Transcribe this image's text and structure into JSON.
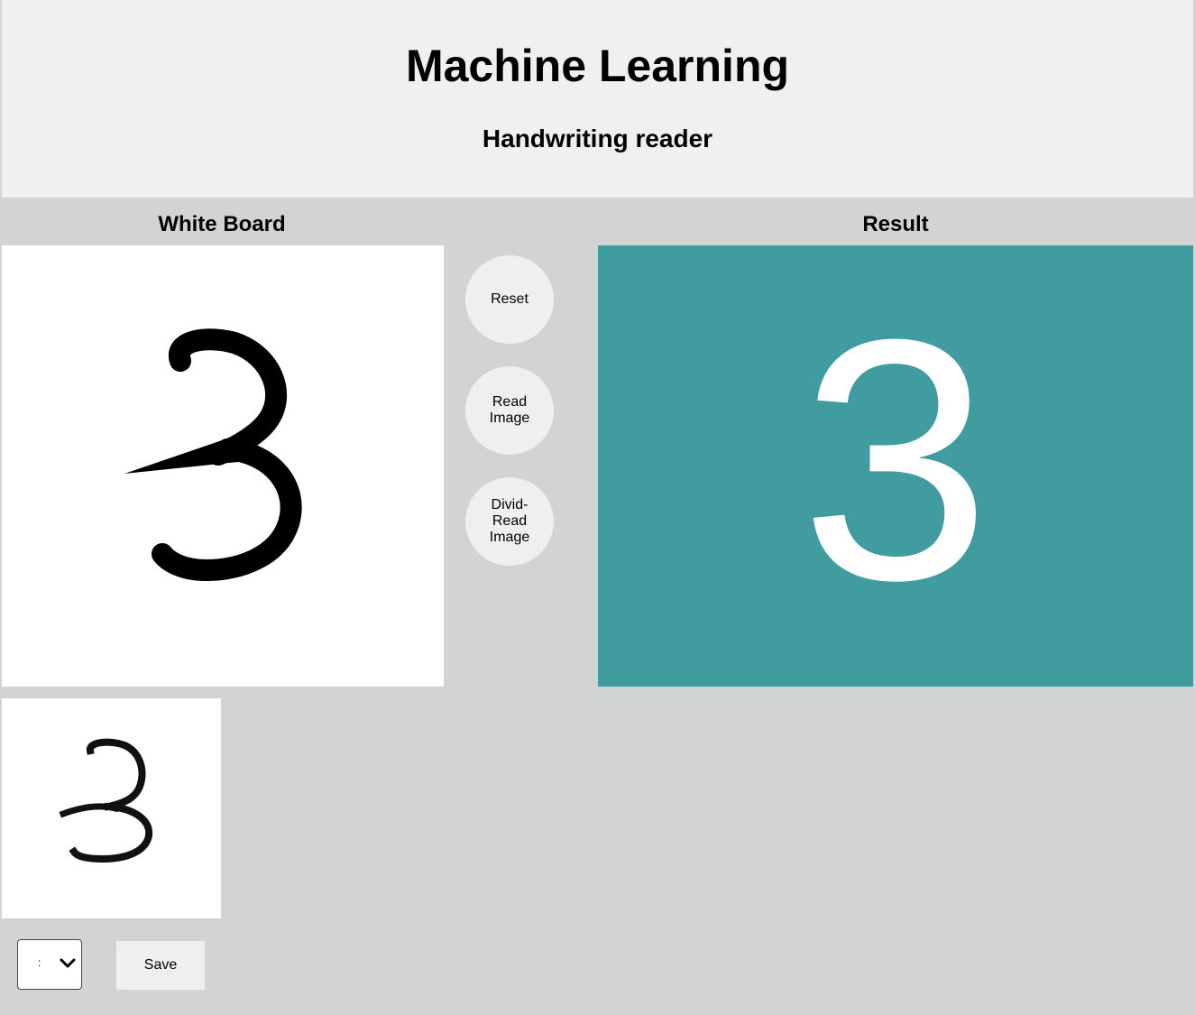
{
  "header": {
    "title": "Machine Learning",
    "subtitle": "Handwriting reader"
  },
  "whiteboard": {
    "label": "White Board"
  },
  "result": {
    "label": "Result",
    "value": "3",
    "background_color": "#409c9f"
  },
  "buttons": {
    "reset": "Reset",
    "read_image": "Read\nImage",
    "divid_read_image": "Divid-\nRead\nImage",
    "save": "Save"
  },
  "select": {
    "value": ":"
  },
  "icons": {
    "dropdown": "chevron-down-icon"
  }
}
